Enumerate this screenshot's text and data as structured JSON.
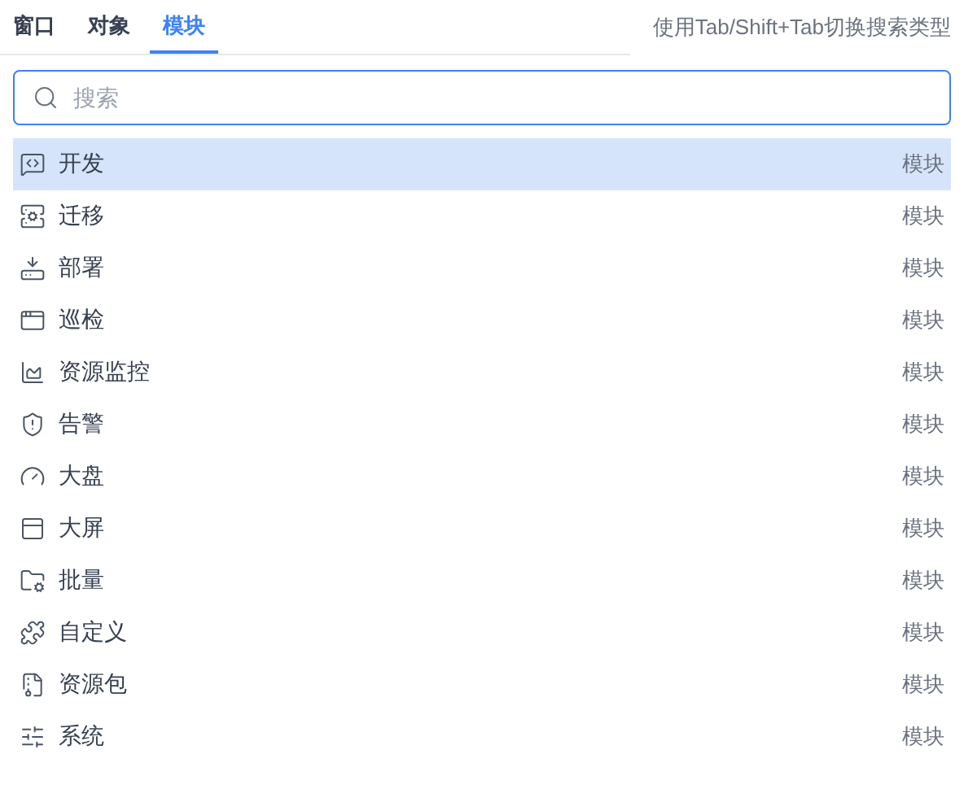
{
  "tabs": [
    {
      "label": "窗口",
      "selected": false
    },
    {
      "label": "对象",
      "selected": false
    },
    {
      "label": "模块",
      "selected": true
    }
  ],
  "hint": "使用Tab/Shift+Tab切换搜索类型",
  "search": {
    "placeholder": "搜索"
  },
  "results": [
    {
      "name": "开发",
      "type": "模块",
      "selected": true
    },
    {
      "name": "迁移",
      "type": "模块",
      "selected": false
    },
    {
      "name": "部署",
      "type": "模块",
      "selected": false
    },
    {
      "name": "巡检",
      "type": "模块",
      "selected": false
    },
    {
      "name": "资源监控",
      "type": "模块",
      "selected": false
    },
    {
      "name": "告警",
      "type": "模块",
      "selected": false
    },
    {
      "name": "大盘",
      "type": "模块",
      "selected": false
    },
    {
      "name": "大屏",
      "type": "模块",
      "selected": false
    },
    {
      "name": "批量",
      "type": "模块",
      "selected": false
    },
    {
      "name": "自定义",
      "type": "模块",
      "selected": false
    },
    {
      "name": "资源包",
      "type": "模块",
      "selected": false
    },
    {
      "name": "系统",
      "type": "模块",
      "selected": false
    }
  ]
}
